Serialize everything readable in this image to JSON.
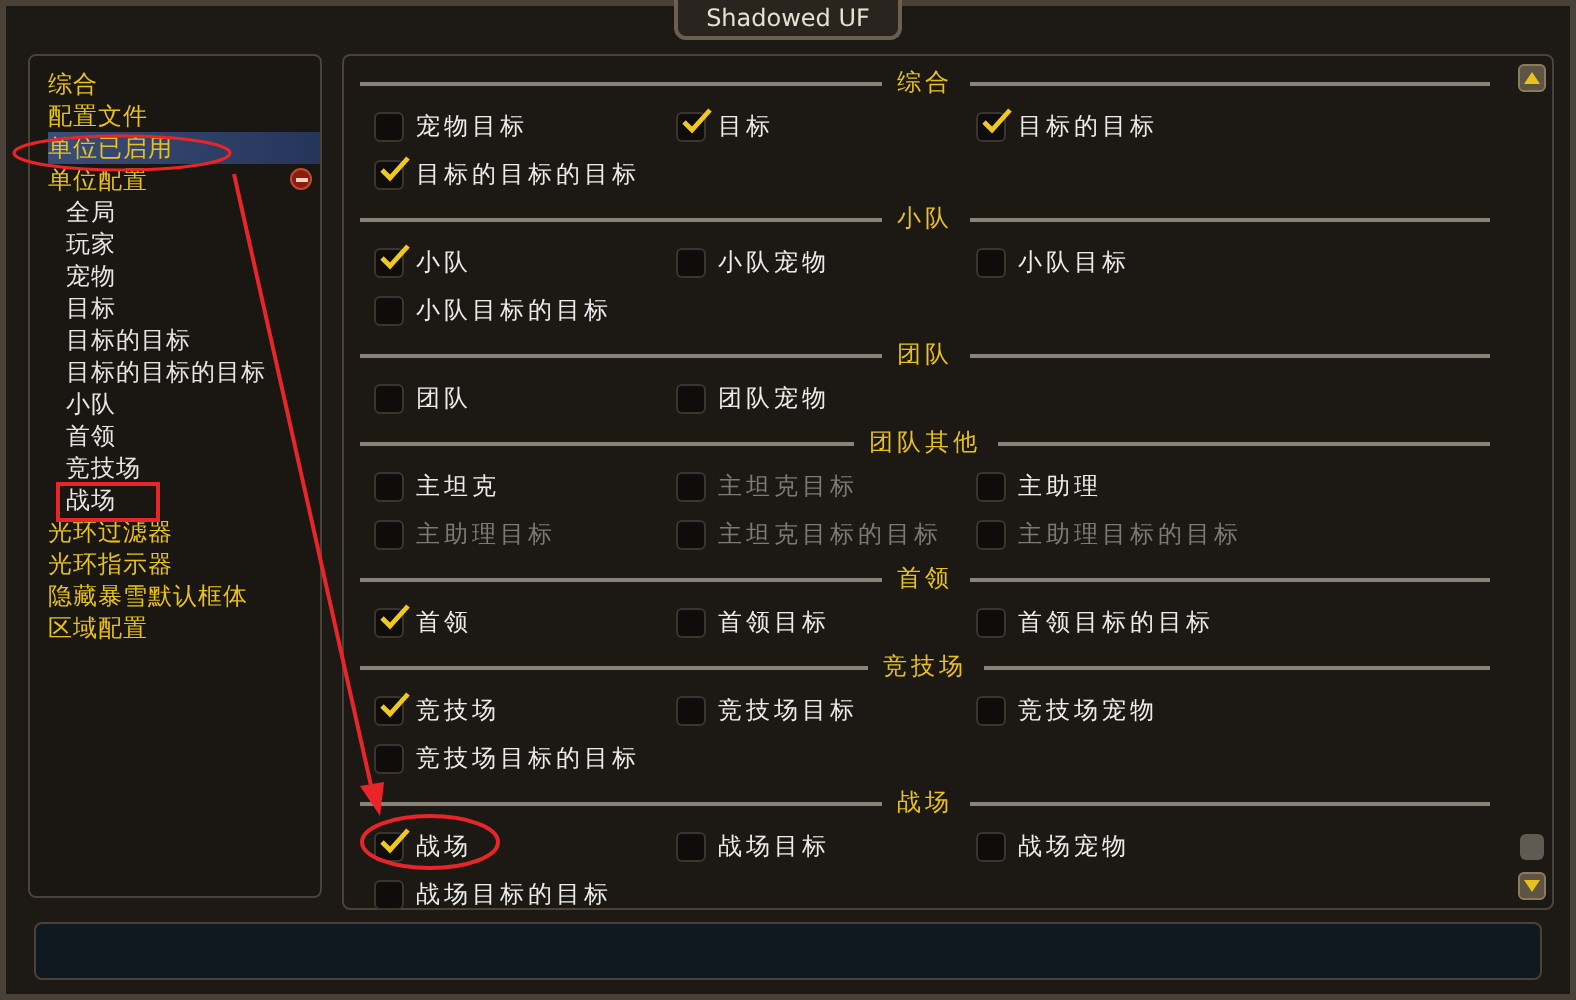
{
  "window": {
    "title": "Shadowed UF"
  },
  "sidebar": {
    "items": [
      {
        "label": "综合",
        "selected": false
      },
      {
        "label": "配置文件",
        "selected": false
      },
      {
        "label": "单位已启用",
        "selected": true
      },
      {
        "label": "单位配置",
        "selected": false,
        "expanded": true,
        "children": [
          {
            "label": "全局",
            "selected": false
          },
          {
            "label": "玩家",
            "selected": false
          },
          {
            "label": "宠物",
            "selected": false
          },
          {
            "label": "目标",
            "selected": false
          },
          {
            "label": "目标的目标",
            "selected": false
          },
          {
            "label": "目标的目标的目标",
            "selected": false
          },
          {
            "label": "小队",
            "selected": false
          },
          {
            "label": "首领",
            "selected": false
          },
          {
            "label": "竞技场",
            "selected": false
          },
          {
            "label": "战场",
            "selected": false
          }
        ]
      },
      {
        "label": "光环过滤器",
        "selected": false
      },
      {
        "label": "光环指示器",
        "selected": false
      },
      {
        "label": "隐藏暴雪默认框体",
        "selected": false
      },
      {
        "label": "区域配置",
        "selected": false
      }
    ]
  },
  "sections": [
    {
      "title": "综合",
      "options": [
        {
          "label": "宠物目标",
          "checked": false,
          "disabled": false
        },
        {
          "label": "目标",
          "checked": true,
          "disabled": false
        },
        {
          "label": "目标的目标",
          "checked": true,
          "disabled": false
        },
        {
          "label": "目标的目标的目标",
          "checked": true,
          "disabled": false
        }
      ]
    },
    {
      "title": "小队",
      "options": [
        {
          "label": "小队",
          "checked": true,
          "disabled": false
        },
        {
          "label": "小队宠物",
          "checked": false,
          "disabled": false
        },
        {
          "label": "小队目标",
          "checked": false,
          "disabled": false
        },
        {
          "label": "小队目标的目标",
          "checked": false,
          "disabled": false
        }
      ]
    },
    {
      "title": "团队",
      "options": [
        {
          "label": "团队",
          "checked": false,
          "disabled": false
        },
        {
          "label": "团队宠物",
          "checked": false,
          "disabled": false
        }
      ]
    },
    {
      "title": "团队其他",
      "options": [
        {
          "label": "主坦克",
          "checked": false,
          "disabled": false
        },
        {
          "label": "主坦克目标",
          "checked": false,
          "disabled": true
        },
        {
          "label": "主助理",
          "checked": false,
          "disabled": false
        },
        {
          "label": "主助理目标",
          "checked": false,
          "disabled": true
        },
        {
          "label": "主坦克目标的目标",
          "checked": false,
          "disabled": true
        },
        {
          "label": "主助理目标的目标",
          "checked": false,
          "disabled": true
        }
      ]
    },
    {
      "title": "首领",
      "options": [
        {
          "label": "首领",
          "checked": true,
          "disabled": false
        },
        {
          "label": "首领目标",
          "checked": false,
          "disabled": false
        },
        {
          "label": "首领目标的目标",
          "checked": false,
          "disabled": false
        }
      ]
    },
    {
      "title": "竞技场",
      "options": [
        {
          "label": "竞技场",
          "checked": true,
          "disabled": false
        },
        {
          "label": "竞技场目标",
          "checked": false,
          "disabled": false
        },
        {
          "label": "竞技场宠物",
          "checked": false,
          "disabled": false
        },
        {
          "label": "竞技场目标的目标",
          "checked": false,
          "disabled": false
        }
      ]
    },
    {
      "title": "战场",
      "options": [
        {
          "label": "战场",
          "checked": true,
          "disabled": false
        },
        {
          "label": "战场目标",
          "checked": false,
          "disabled": false
        },
        {
          "label": "战场宠物",
          "checked": false,
          "disabled": false
        },
        {
          "label": "战场目标的目标",
          "checked": false,
          "disabled": false
        }
      ]
    }
  ]
}
